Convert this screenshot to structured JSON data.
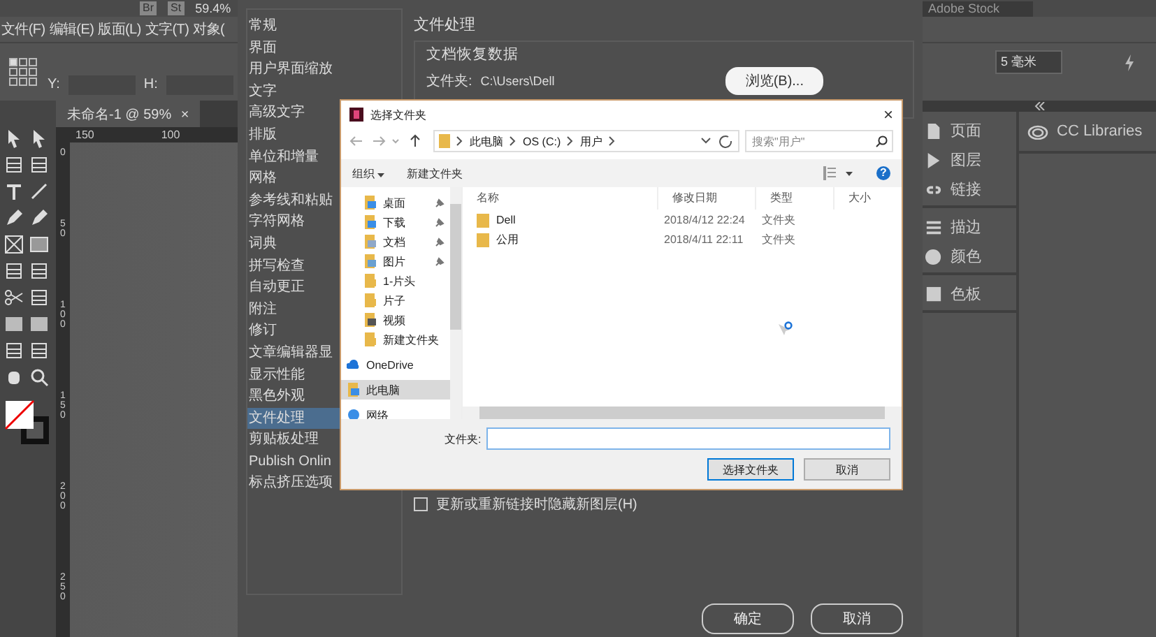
{
  "app": {
    "top_bar": {
      "bridge": "Br",
      "stock": "St",
      "zoom": "59.4%",
      "stock_search": "Adobe Stock"
    },
    "menu": [
      "文件(F)",
      "编辑(E)",
      "版面(L)",
      "文字(T)",
      "对象("
    ],
    "control_bar": {
      "y_label": "Y:",
      "h_label": "H:",
      "offset": "5 毫米"
    },
    "document_tab": {
      "title": "未命名-1 @ 59%",
      "close": "×"
    },
    "ruler": {
      "horizontal": [
        "150",
        "100"
      ],
      "vertical": [
        "0",
        "50",
        "100",
        "150",
        "200",
        "250"
      ]
    }
  },
  "panels": {
    "groups": [
      [
        {
          "kind": "pages",
          "label": "页面"
        },
        {
          "kind": "layers",
          "label": "图层"
        },
        {
          "kind": "links",
          "label": "链接"
        }
      ],
      [
        {
          "kind": "stroke",
          "label": "描边"
        },
        {
          "kind": "color",
          "label": "颜色"
        }
      ],
      [
        {
          "kind": "swatches",
          "label": "色板"
        }
      ]
    ],
    "libraries": "CC Libraries"
  },
  "preferences": {
    "categories": [
      {
        "label": "常规",
        "selected": false
      },
      {
        "label": "界面",
        "selected": false
      },
      {
        "label": "用户界面缩放",
        "selected": false
      },
      {
        "label": "文字",
        "selected": false
      },
      {
        "label": "高级文字",
        "selected": false
      },
      {
        "label": "排版",
        "selected": false
      },
      {
        "label": "单位和增量",
        "selected": false
      },
      {
        "label": "网格",
        "selected": false
      },
      {
        "label": "参考线和粘贴",
        "selected": false
      },
      {
        "label": "字符网格",
        "selected": false
      },
      {
        "label": "词典",
        "selected": false
      },
      {
        "label": "拼写检查",
        "selected": false
      },
      {
        "label": "自动更正",
        "selected": false
      },
      {
        "label": "附注",
        "selected": false
      },
      {
        "label": "修订",
        "selected": false
      },
      {
        "label": "文章编辑器显",
        "selected": false
      },
      {
        "label": "显示性能",
        "selected": false
      },
      {
        "label": "黑色外观",
        "selected": false
      },
      {
        "label": "文件处理",
        "selected": true
      },
      {
        "label": "剪贴板处理",
        "selected": false
      },
      {
        "label": "Publish Onlin",
        "selected": false
      },
      {
        "label": "标点挤压选项",
        "selected": false
      }
    ],
    "section_title": "文件处理",
    "group_title": "文档恢复数据",
    "folder_label": "文件夹:",
    "folder_path": "C:\\Users\\Dell",
    "browse_button": "浏览(B)...",
    "hide_layers": {
      "label": "更新或重新链接时隐藏新图层(H)",
      "checked": false
    },
    "buttons": [
      "确定",
      "取消"
    ]
  },
  "dialog": {
    "title": "选择文件夹",
    "close": "×",
    "path": [
      "此电脑",
      "OS (C:)",
      "用户"
    ],
    "search": {
      "placeholder": "搜索\"用户\""
    },
    "toolbar": {
      "organize": "组织",
      "new_folder": "新建文件夹",
      "help": "?"
    },
    "nav": [
      {
        "kind": "desktop",
        "label": "桌面",
        "pinned": true,
        "selected": false
      },
      {
        "kind": "download",
        "label": "下载",
        "pinned": true,
        "selected": false
      },
      {
        "kind": "document",
        "label": "文档",
        "pinned": true,
        "selected": false
      },
      {
        "kind": "picture",
        "label": "图片",
        "pinned": true,
        "selected": false
      },
      {
        "kind": "folder",
        "label": "1-片头",
        "pinned": false,
        "selected": false
      },
      {
        "kind": "folder",
        "label": "片子",
        "pinned": false,
        "selected": false
      },
      {
        "kind": "video",
        "label": "视频",
        "pinned": false,
        "selected": false
      },
      {
        "kind": "folder",
        "label": "新建文件夹",
        "pinned": false,
        "selected": false
      },
      {
        "kind": "onedrive",
        "label": "OneDrive",
        "pinned": false,
        "selected": false
      },
      {
        "kind": "pc",
        "label": "此电脑",
        "pinned": false,
        "selected": true
      },
      {
        "kind": "network",
        "label": "网络",
        "pinned": false,
        "selected": false
      }
    ],
    "columns": [
      "名称",
      "修改日期",
      "类型",
      "大小"
    ],
    "rows": [
      {
        "name": "Dell",
        "modified": "2018/4/12 22:24",
        "type": "文件夹"
      },
      {
        "name": "公用",
        "modified": "2018/4/11 22:11",
        "type": "文件夹"
      }
    ],
    "folder_label": "文件夹:",
    "buttons": [
      "选择文件夹",
      "取消"
    ]
  }
}
